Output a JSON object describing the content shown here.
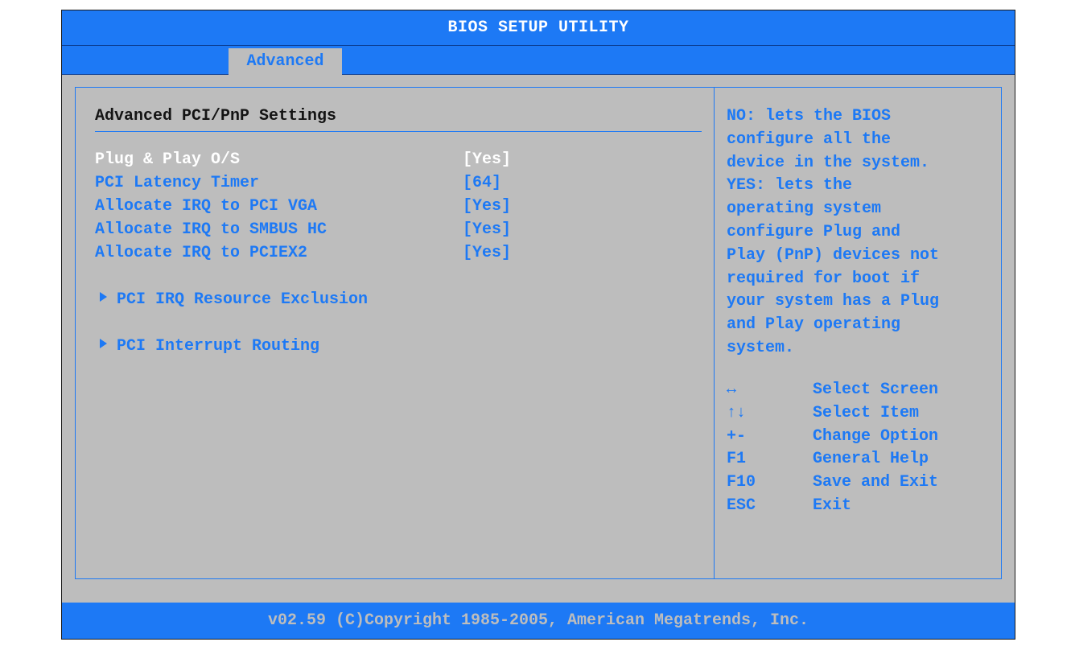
{
  "window": {
    "title": "BIOS SETUP UTILITY"
  },
  "tabs": [
    {
      "label": "Advanced"
    }
  ],
  "main": {
    "section_title": "Advanced PCI/PnP Settings",
    "settings": [
      {
        "label": "Plug & Play O/S",
        "value": "[Yes]"
      },
      {
        "label": "PCI Latency Timer",
        "value": "[64]"
      },
      {
        "label": "Allocate IRQ to PCI VGA",
        "value": "[Yes]"
      },
      {
        "label": "Allocate IRQ to SMBUS HC",
        "value": "[Yes]"
      },
      {
        "label": "Allocate IRQ to PCIEX2",
        "value": "[Yes]"
      }
    ],
    "submenus": [
      {
        "label": "PCI IRQ Resource Exclusion",
        "icon": "arrow-right-icon"
      },
      {
        "label": "PCI Interrupt Routing",
        "icon": "arrow-right-icon"
      }
    ]
  },
  "help": {
    "lines": [
      "NO: lets the BIOS",
      "configure all the",
      "device in the system.",
      "YES: lets the",
      "operating system",
      "configure Plug and",
      "Play (PnP) devices not",
      "required for boot if",
      "your system has a Plug",
      "and Play operating",
      "system."
    ],
    "keys": [
      {
        "key": "↔",
        "desc": "Select Screen"
      },
      {
        "key": "↑↓",
        "desc": "Select Item"
      },
      {
        "key": "+-",
        "desc": "Change Option"
      },
      {
        "key": "F1",
        "desc": "General Help"
      },
      {
        "key": "F10",
        "desc": "Save and Exit"
      },
      {
        "key": "ESC",
        "desc": "Exit"
      }
    ]
  },
  "footer": {
    "text": "v02.59 (C)Copyright 1985-2005, American Megatrends, Inc."
  },
  "colors": {
    "accent": "#1d79f5",
    "background": "#bdbdbd",
    "selected_text": "#ffffff"
  }
}
